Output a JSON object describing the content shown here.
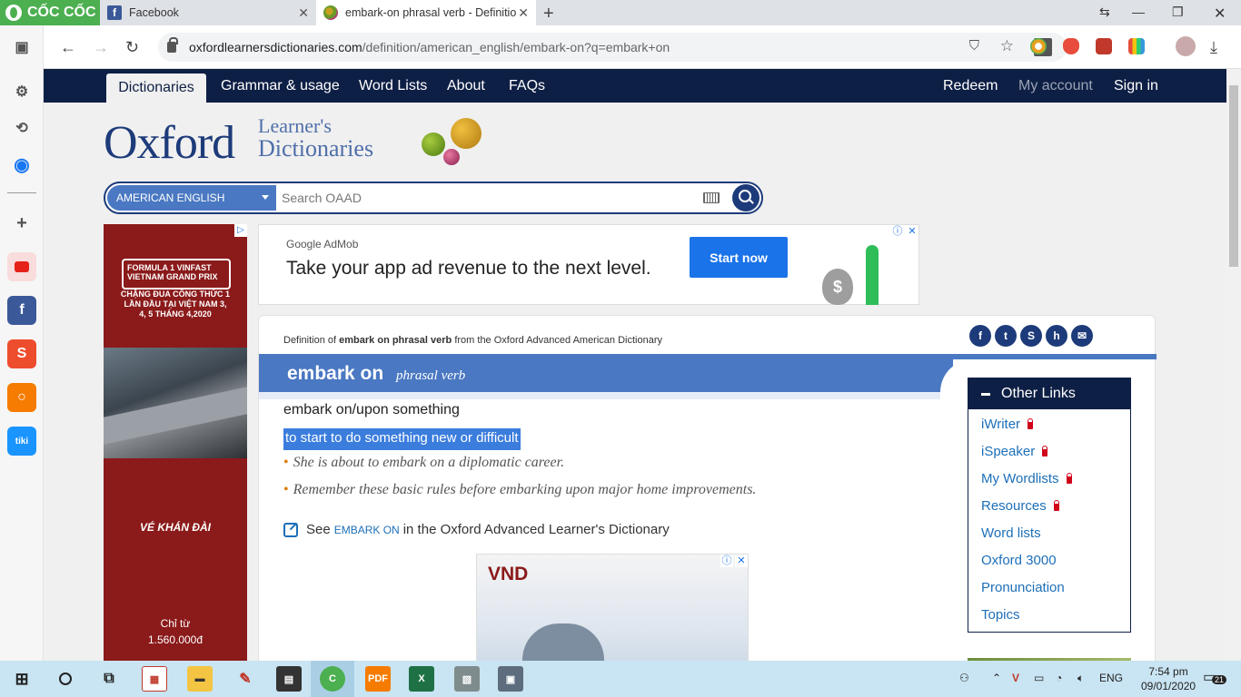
{
  "browser": {
    "brand": "CỐC CỐC",
    "tabs": [
      {
        "title": "Facebook",
        "active": false
      },
      {
        "title": "embark-on phrasal verb - Definitio",
        "active": true
      }
    ],
    "url_host": "oxfordlearnersdictionaries.com",
    "url_path": "/definition/american_english/embark-on?q=embark+on"
  },
  "site": {
    "nav": {
      "left": [
        "Dictionaries",
        "Grammar & usage",
        "Word Lists",
        "About",
        "FAQs"
      ],
      "right": [
        "Redeem",
        "My account",
        "Sign in"
      ],
      "active": "Dictionaries"
    },
    "brand_main": "Oxford",
    "brand_sub1": "Learner's",
    "brand_sub2": "Dictionaries",
    "search": {
      "dictionary": "AMERICAN ENGLISH",
      "placeholder": "Search OAAD"
    }
  },
  "ads": {
    "left": {
      "f1_line1": "FORMULA 1 VINFAST",
      "f1_line2": "VIETNAM GRAND PRIX",
      "tagline": "CHẶNG ĐUA CÔNG THỨC 1 LẦN ĐẦU TẠI VIỆT NAM 3, 4, 5 THÁNG 4,2020",
      "cta": "VÉ KHÁN ĐÀI",
      "price_label": "Chỉ từ",
      "price": "1.560.000đ"
    },
    "top": {
      "brand": "Google AdMob",
      "headline": "Take your app ad revenue to the next level.",
      "button": "Start now"
    },
    "bottom": {
      "text": "VND"
    }
  },
  "entry": {
    "def_of_prefix": "Definition of",
    "def_of_term": "embark on phrasal verb",
    "def_of_suffix": "from the Oxford Advanced American Dictionary",
    "headword": "embark on",
    "pos": "phrasal verb",
    "pv_form": "embark on/upon something",
    "definition": "to start to do something new or difficult",
    "examples": [
      "She is about to embark on a diplomatic career.",
      "Remember these basic rules before embarking upon major home improvements."
    ],
    "see_prefix": "See",
    "see_link": "EMBARK ON",
    "see_suffix": "in the Oxford Advanced Learner's Dictionary"
  },
  "other_links": {
    "title": "Other Links",
    "items": [
      {
        "label": "iWriter",
        "locked": true
      },
      {
        "label": "iSpeaker",
        "locked": true
      },
      {
        "label": "My Wordlists",
        "locked": true
      },
      {
        "label": "Resources",
        "locked": true
      },
      {
        "label": "Word lists",
        "locked": false
      },
      {
        "label": "Oxford 3000",
        "locked": false
      },
      {
        "label": "Pronunciation",
        "locked": false
      },
      {
        "label": "Topics",
        "locked": false
      }
    ]
  },
  "taskbar": {
    "lang": "ENG",
    "time": "7:54 pm",
    "date": "09/01/2020",
    "notifications": "21"
  },
  "colors": {
    "nav_bg": "#0e1f45",
    "headword_bar": "#4a78c2",
    "link": "#1d6fb8",
    "selection": "#3b7ddd"
  }
}
